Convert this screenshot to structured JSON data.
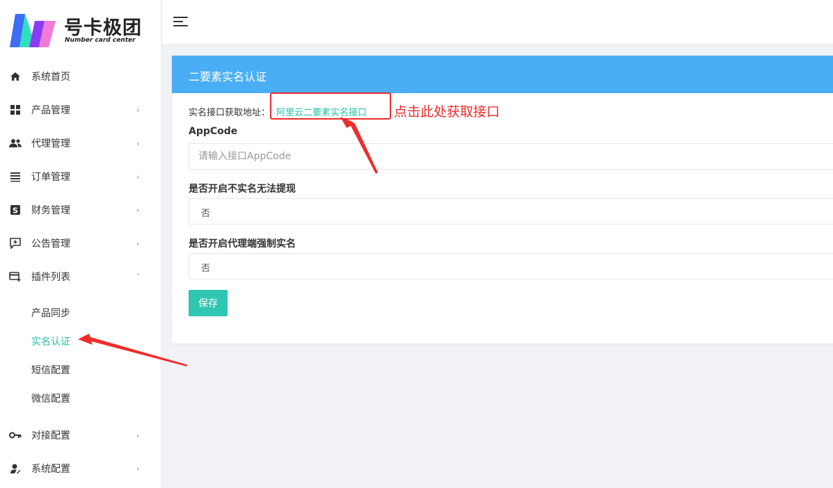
{
  "brand": {
    "title": "号卡极团",
    "subtitle": "Number card center",
    "colors": {
      "blue": "#3d6cf5",
      "teal": "#2ee0c0",
      "purple": "#8a3cf0",
      "pink": "#f07ad8"
    }
  },
  "sidebar": {
    "items": [
      {
        "label": "系统首页",
        "icon": "home-icon",
        "has_arrow": false
      },
      {
        "label": "产品管理",
        "icon": "grid-icon",
        "has_arrow": true,
        "arrow": "›"
      },
      {
        "label": "代理管理",
        "icon": "users-icon",
        "has_arrow": true,
        "arrow": "›"
      },
      {
        "label": "订单管理",
        "icon": "list-icon",
        "has_arrow": true,
        "arrow": "›"
      },
      {
        "label": "财务管理",
        "icon": "dollar-icon",
        "has_arrow": true,
        "arrow": "›"
      },
      {
        "label": "公告管理",
        "icon": "announcement-icon",
        "has_arrow": true,
        "arrow": "›"
      },
      {
        "label": "插件列表",
        "icon": "plugin-icon",
        "has_arrow": true,
        "arrow": "ˇ",
        "expanded": true
      }
    ],
    "sub_items": [
      {
        "label": "产品同步",
        "active": false
      },
      {
        "label": "实名认证",
        "active": true
      },
      {
        "label": "短信配置",
        "active": false
      },
      {
        "label": "微信配置",
        "active": false
      }
    ],
    "bottom_items": [
      {
        "label": "对接配置",
        "icon": "key-icon",
        "has_arrow": true,
        "arrow": "›"
      },
      {
        "label": "系统配置",
        "icon": "user-settings-icon",
        "has_arrow": true,
        "arrow": "›"
      }
    ],
    "active_color": "#26c1a8"
  },
  "card": {
    "title": "二要素实名认证",
    "header_color": "#4aaef5",
    "api_label": "实名接口获取地址：",
    "api_link": "阿里云二要素实名接口",
    "fields": {
      "appcode": {
        "label": "AppCode",
        "placeholder": "请输入接口AppCode",
        "value": ""
      },
      "withdraw": {
        "label": "是否开启不实名无法提现",
        "value": "否"
      },
      "agent_force": {
        "label": "是否开启代理端强制实名",
        "value": "否"
      }
    },
    "save_label": "保存",
    "save_color": "#2fc6b2"
  },
  "annotation": {
    "text": "点击此处获取接口",
    "color": "#ef2b2b"
  }
}
